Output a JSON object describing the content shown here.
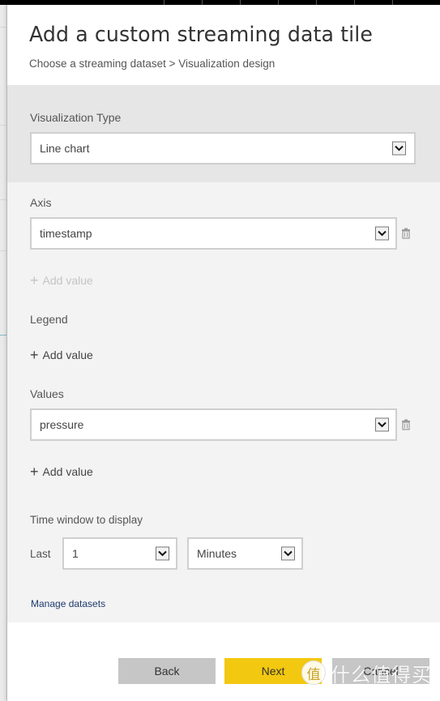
{
  "dialog": {
    "title": "Add a custom streaming data tile",
    "breadcrumb": "Choose a streaming dataset > Visualization design"
  },
  "visualization_type": {
    "label": "Visualization Type",
    "selected": "Line chart"
  },
  "axis": {
    "label": "Axis",
    "fields": [
      {
        "value": "timestamp"
      }
    ],
    "add_label": "Add value",
    "add_enabled": false
  },
  "legend": {
    "label": "Legend",
    "add_label": "Add value",
    "add_enabled": true
  },
  "values": {
    "label": "Values",
    "fields": [
      {
        "value": "pressure"
      }
    ],
    "add_label": "Add value",
    "add_enabled": true
  },
  "time_window": {
    "label": "Time window to display",
    "prefix": "Last",
    "amount": "1",
    "unit": "Minutes"
  },
  "links": {
    "manage_datasets": "Manage datasets"
  },
  "buttons": {
    "back": "Back",
    "next": "Next",
    "cancel": "Cancel"
  },
  "icons": {
    "dropdown": "chevron-down-icon",
    "delete": "trash-icon",
    "add": "plus-icon"
  },
  "colors": {
    "primary_button": "#f2c811",
    "secondary_button": "#c6c6c6",
    "link": "#1f3a6e",
    "viz_section_bg": "#e6e6e6",
    "main_section_bg": "#f3f3f3"
  },
  "watermark": {
    "badge": "值",
    "text": "什么值得买"
  }
}
